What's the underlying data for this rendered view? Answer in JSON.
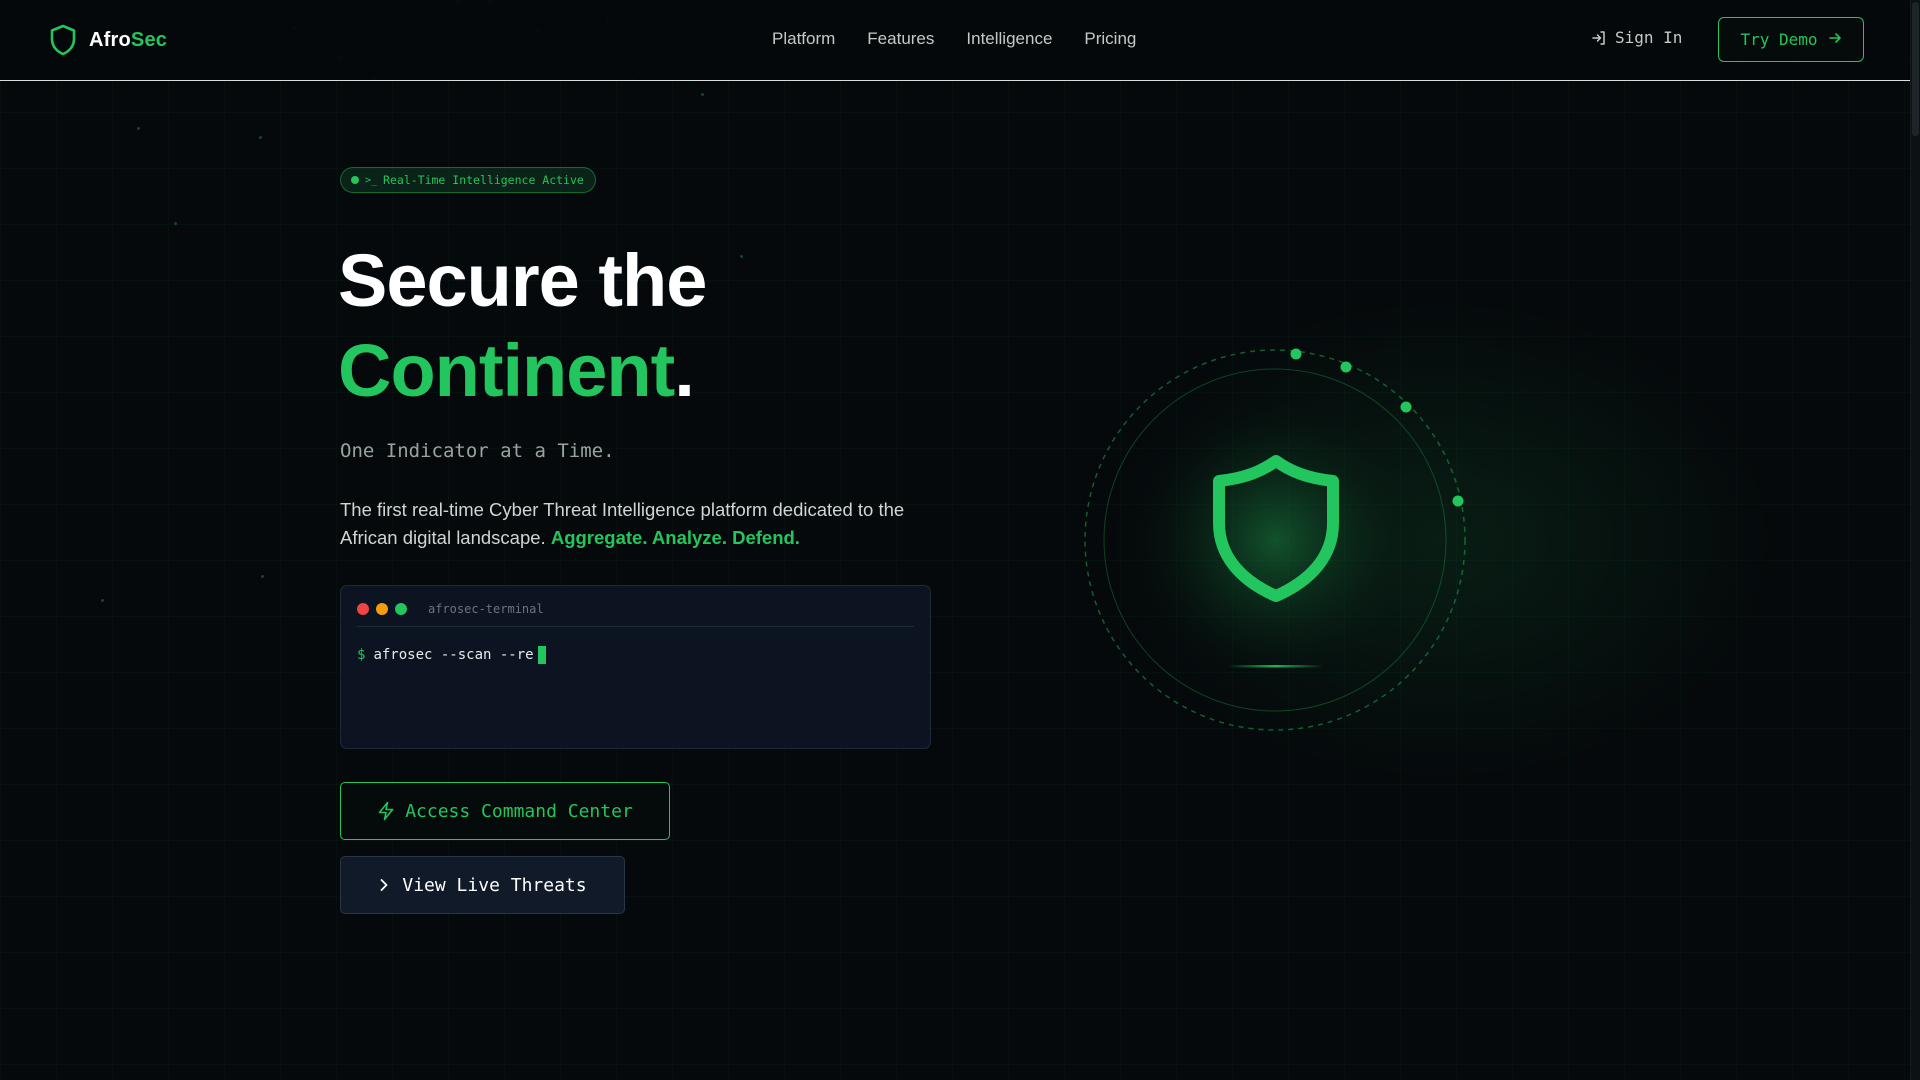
{
  "brand": {
    "name_part_1": "Afro",
    "name_part_2": "Sec",
    "icon": "shield-icon",
    "accent_color": "#22c55e",
    "background_color": "#05090b"
  },
  "nav": {
    "links": [
      {
        "label": "Platform"
      },
      {
        "label": "Features"
      },
      {
        "label": "Intelligence"
      },
      {
        "label": "Pricing"
      }
    ],
    "sign_in_label": "Sign In",
    "sign_in_icon": "sign-in-icon",
    "try_demo_label": "Try Demo",
    "try_demo_icon": "arrow-right-icon"
  },
  "hero": {
    "badge_glyph": ">_",
    "badge_text": "Real-Time Intelligence Active",
    "headline_line_1": "Secure the",
    "headline_line_2": "Continent",
    "headline_period": ".",
    "tagline": "One Indicator at a Time.",
    "description": "The first real-time Cyber Threat Intelligence platform dedicated to the African digital landscape.",
    "description_highlight": "Aggregate. Analyze. Defend."
  },
  "terminal": {
    "title": "afrosec-terminal",
    "prompt": "$",
    "command": "afrosec --scan --re",
    "dot_colors": [
      "#ef4444",
      "#f59e0b",
      "#22c55e"
    ],
    "background_color": "#0c1422"
  },
  "actions": {
    "primary_label": "Access Command Center",
    "primary_icon": "lightning-icon",
    "secondary_label": "View Live Threats",
    "secondary_icon": "chevron-right-icon"
  },
  "visual": {
    "icon": "shield-icon",
    "orbit_dots": 4
  }
}
